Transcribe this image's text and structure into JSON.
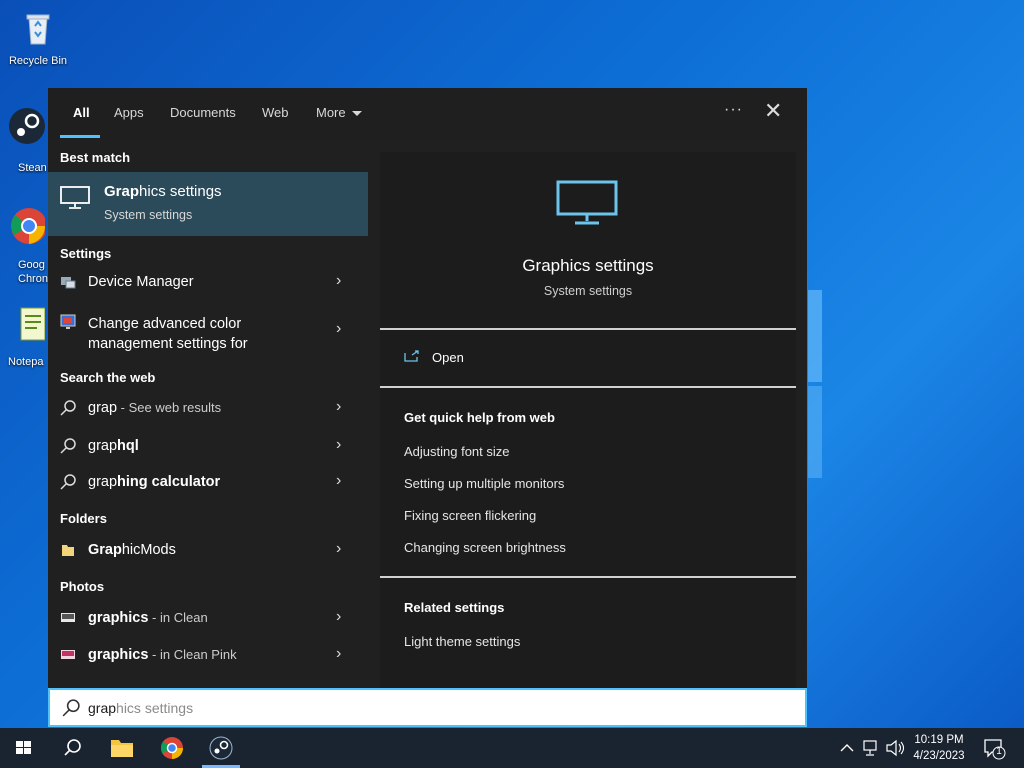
{
  "desktop": {
    "icons": [
      {
        "label": "Recycle Bin"
      },
      {
        "label": "Stean"
      },
      {
        "label": "Goog\nChron"
      },
      {
        "label": "Notepa"
      }
    ]
  },
  "search_panel": {
    "tabs": [
      {
        "label": "All",
        "active": true
      },
      {
        "label": "Apps"
      },
      {
        "label": "Documents"
      },
      {
        "label": "Web"
      },
      {
        "label": "More"
      }
    ],
    "ellipsis": "···",
    "close": "✕",
    "sections": {
      "best_match": "Best match",
      "settings": "Settings",
      "search_web": "Search the web",
      "folders": "Folders",
      "photos": "Photos"
    },
    "best_match": {
      "title_hl": "Grap",
      "title_rest": "hics settings",
      "subtitle": "System settings"
    },
    "settings_items": [
      {
        "label": "Device Manager"
      },
      {
        "label_line1": "Change advanced color",
        "label_line2": "management settings for"
      }
    ],
    "web_items": [
      {
        "hl": "grap",
        "rest": "",
        "sub": " - See web results"
      },
      {
        "hl": "",
        "pre": "grap",
        "rest": "hql"
      },
      {
        "pre": "grap",
        "rest": "hing calculator"
      }
    ],
    "folder_items": [
      {
        "pre": "Grap",
        "rest": "hicMods"
      }
    ],
    "photo_items": [
      {
        "label": "graphics",
        "sub": " - in Clean"
      },
      {
        "label": "graphics",
        "sub": " - in Clean Pink"
      }
    ],
    "preview": {
      "title": "Graphics settings",
      "subtitle": "System settings",
      "open": "Open",
      "quick_help_heading": "Get quick help from web",
      "quick_help_links": [
        "Adjusting font size",
        "Setting up multiple monitors",
        "Fixing screen flickering",
        "Changing screen brightness"
      ],
      "related_heading": "Related settings",
      "related_links": [
        "Light theme settings"
      ]
    },
    "search": {
      "typed": "grap",
      "suggestion": "hics settings"
    }
  },
  "taskbar": {
    "time": "10:19 PM",
    "date": "4/23/2023",
    "notification_count": "1"
  },
  "colors": {
    "accent": "#4cc2ff",
    "best_match_bg": "#2b4a5a",
    "panel_bg": "#202020"
  }
}
